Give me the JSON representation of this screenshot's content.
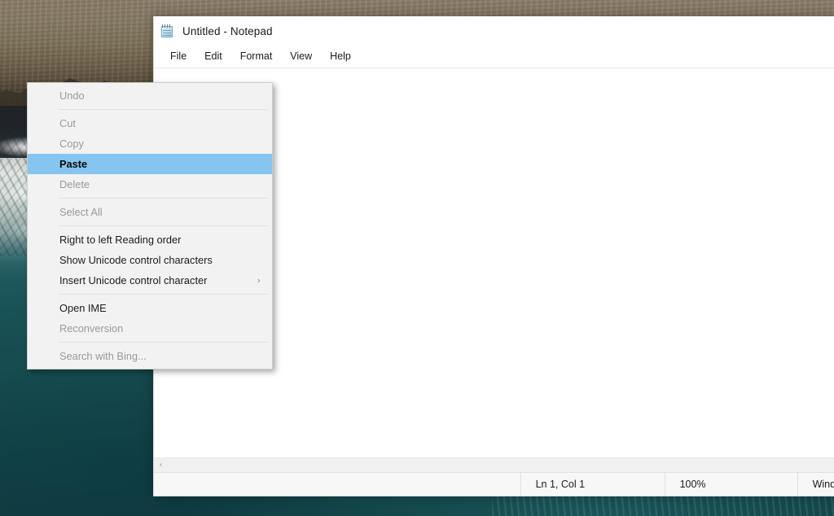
{
  "desktop": {
    "wallpaper_description": "aerial coastal photo: tan sandstone cliff at top, white surf over rocks, deep teal ocean",
    "colors": {
      "ocean": "#16494f",
      "cliff": "#8a7d68",
      "surf": "#e2e7e2",
      "rock_dark": "#2d2a24"
    }
  },
  "notepad": {
    "title": "Untitled - Notepad",
    "icon": "notepad-icon",
    "menubar": [
      {
        "label": "File"
      },
      {
        "label": "Edit"
      },
      {
        "label": "Format"
      },
      {
        "label": "View"
      },
      {
        "label": "Help"
      }
    ],
    "text_content": "",
    "scrollbar": {
      "left_arrow": "‹"
    },
    "statusbar": {
      "position": "Ln 1, Col 1",
      "zoom": "100%",
      "line_ending": "Windo"
    }
  },
  "context_menu": {
    "highlight_color": "#85c5ef",
    "items": [
      {
        "label": "Undo",
        "state": "disabled",
        "separator_after": true,
        "submenu": false
      },
      {
        "label": "Cut",
        "state": "disabled",
        "separator_after": false,
        "submenu": false
      },
      {
        "label": "Copy",
        "state": "disabled",
        "separator_after": false,
        "submenu": false
      },
      {
        "label": "Paste",
        "state": "highlight",
        "separator_after": false,
        "submenu": false
      },
      {
        "label": "Delete",
        "state": "disabled",
        "separator_after": true,
        "submenu": false
      },
      {
        "label": "Select All",
        "state": "disabled",
        "separator_after": true,
        "submenu": false
      },
      {
        "label": "Right to left Reading order",
        "state": "enabled",
        "separator_after": false,
        "submenu": false
      },
      {
        "label": "Show Unicode control characters",
        "state": "enabled",
        "separator_after": false,
        "submenu": false
      },
      {
        "label": "Insert Unicode control character",
        "state": "enabled",
        "separator_after": true,
        "submenu": true,
        "submenu_arrow": "›"
      },
      {
        "label": "Open IME",
        "state": "enabled",
        "separator_after": false,
        "submenu": false
      },
      {
        "label": "Reconversion",
        "state": "disabled",
        "separator_after": true,
        "submenu": false
      },
      {
        "label": "Search with Bing...",
        "state": "disabled",
        "separator_after": false,
        "submenu": false
      }
    ]
  }
}
